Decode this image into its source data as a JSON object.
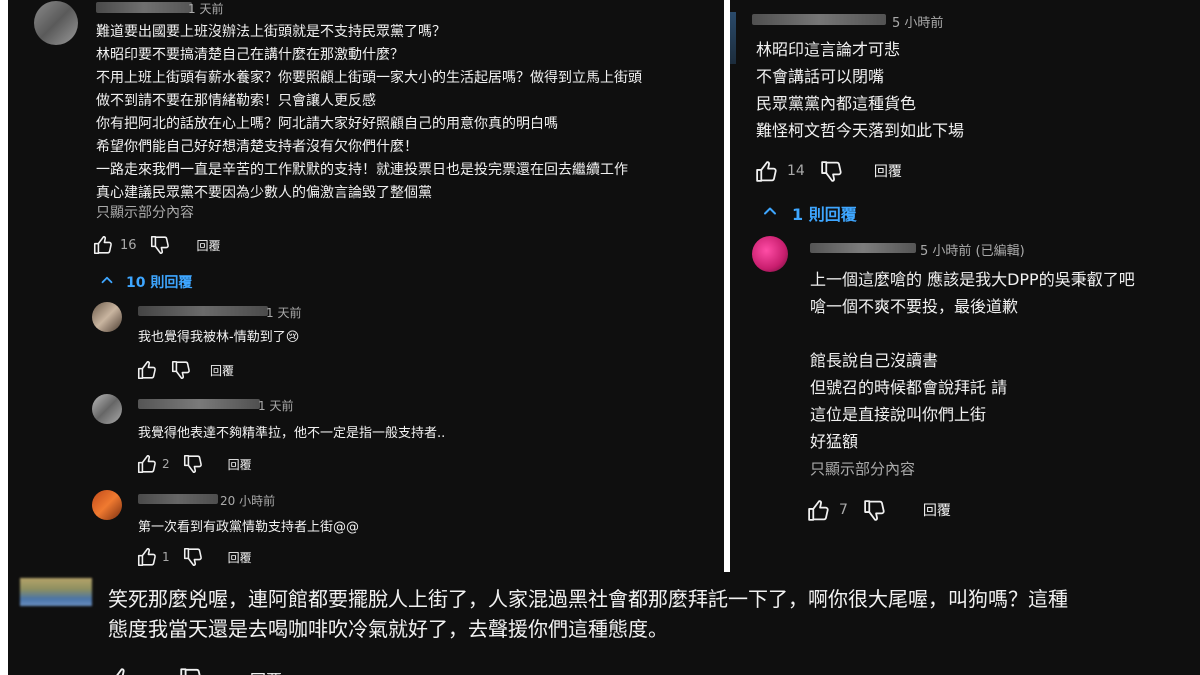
{
  "colors": {
    "background": "#0f0f0f",
    "text": "#f1f1f1",
    "secondary": "#aaaaaa",
    "link": "#3ea6ff"
  },
  "left": {
    "top_comment": {
      "time": "1 天前",
      "lines": [
        "難道要出國要上班沒辦法上街頭就是不支持民眾黨了嗎？",
        "林昭印要不要搞清楚自己在講什麼在那激動什麼？",
        "不用上班上街頭有薪水養家？你要照顧上街頭一家大小的生活起居嗎？做得到立馬上街頭",
        "做不到請不要在那情緒勒索！只會讓人更反感",
        "你有把阿北的話放在心上嗎？阿北請大家好好照顧自己的用意你真的明白嗎",
        "希望你們能自己好好想清楚支持者沒有欠你們什麼！",
        "一路走來我們一直是辛苦的工作默默的支持！就連投票日也是投完票還在回去繼續工作",
        "真心建議民眾黨不要因為少數人的偏激言論毀了整個黨"
      ],
      "show_more": "只顯示部分內容",
      "likes": "16",
      "reply_label": "回覆",
      "icons": [
        "thumbs-up-icon",
        "thumbs-down-icon"
      ]
    },
    "replies_toggle": "10 則回覆",
    "replies": [
      {
        "time": "1 天前",
        "text": "我也覺得我被林-情勒到了😢",
        "likes": "",
        "reply_label": "回覆"
      },
      {
        "time": "1 天前",
        "text": "我覺得他表達不夠精準拉，他不一定是指一般支持者..",
        "likes": "2",
        "reply_label": "回覆"
      },
      {
        "time": "20 小時前",
        "text": "第一次看到有政黨情勒支持者上街@@",
        "likes": "1",
        "reply_label": "回覆"
      }
    ]
  },
  "right": {
    "top_comment": {
      "time": "5 小時前",
      "lines": [
        "林昭印這言論才可悲",
        "不會講話可以閉嘴",
        "民眾黨黨內都這種貨色",
        "難怪柯文哲今天落到如此下場"
      ],
      "likes": "14",
      "reply_label": "回覆"
    },
    "replies_toggle": "1 則回覆",
    "reply": {
      "time": "5 小時前 (已編輯)",
      "lines": [
        "上一個這麼嗆的 應該是我大DPP的吳秉叡了吧",
        "嗆一個不爽不要投，最後道歉",
        "",
        "館長說自己沒讀書",
        "但號召的時候都會說拜託 請",
        "這位是直接說叫你們上街",
        "好猛額"
      ],
      "show_more": "只顯示部分內容",
      "likes": "7",
      "reply_label": "回覆"
    }
  },
  "bottom": {
    "comment": {
      "lines": [
        "笑死那麼兇喔，連阿館都要擺脫人上街了，人家混過黑社會都那麼拜託一下了，啊你很大尾喔，叫狗嗎？這種",
        "態度我當天還是去喝咖啡吹冷氣就好了，去聲援你們這種態度。"
      ],
      "reply_label": "回覆"
    }
  }
}
